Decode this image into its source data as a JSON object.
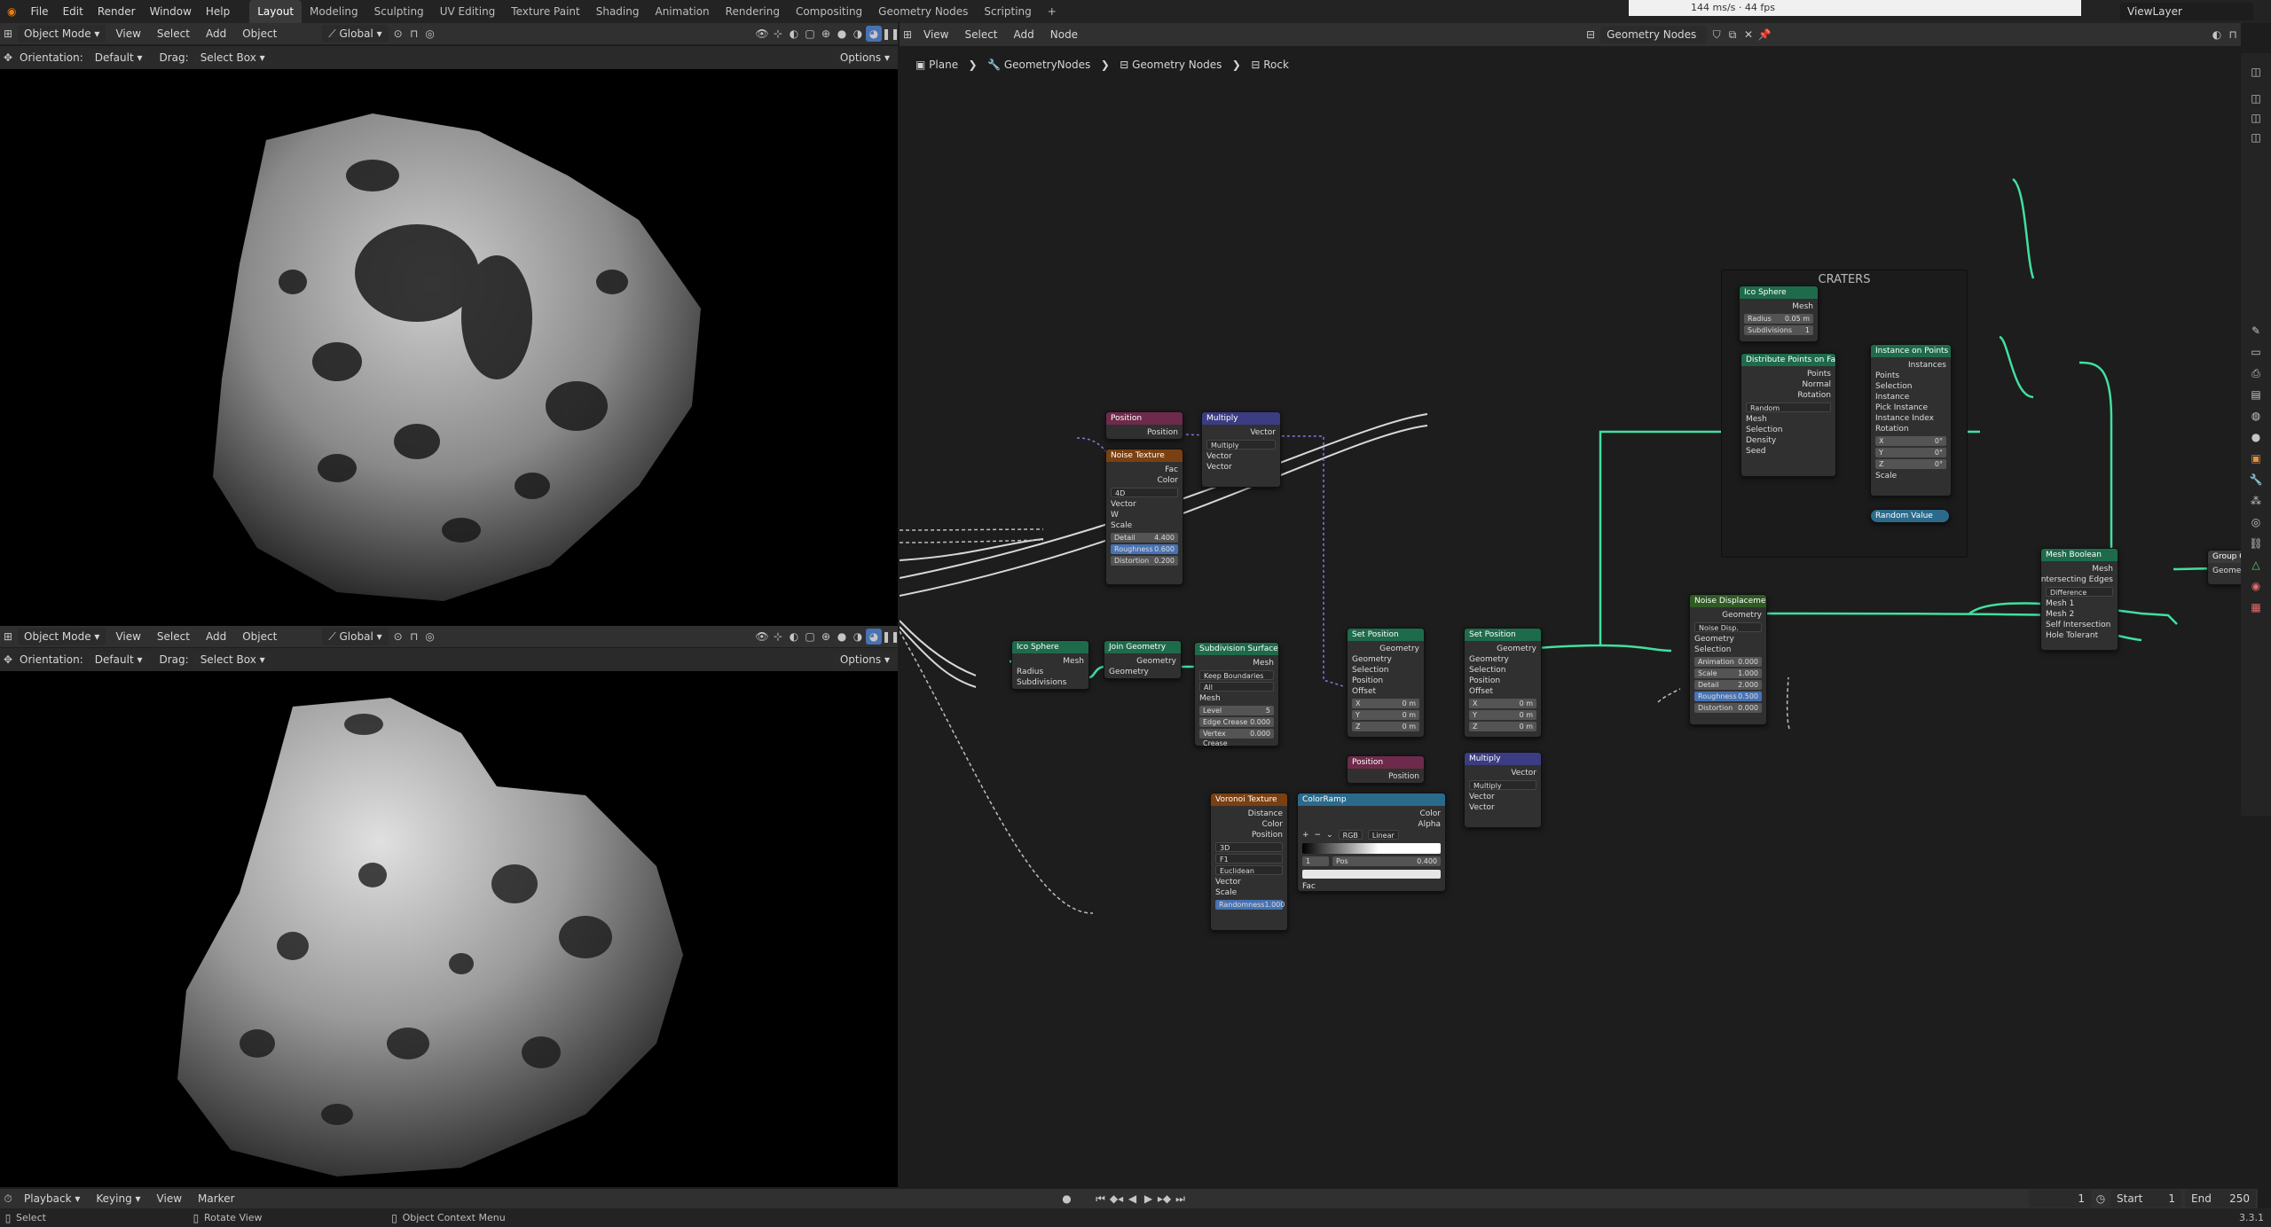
{
  "menu": {
    "items": [
      "File",
      "Edit",
      "Render",
      "Window",
      "Help"
    ],
    "workspaces": [
      "Layout",
      "Modeling",
      "Sculpting",
      "UV Editing",
      "Texture Paint",
      "Shading",
      "Animation",
      "Rendering",
      "Compositing",
      "Geometry Nodes",
      "Scripting"
    ],
    "active_workspace": "Layout",
    "add_tab": "+",
    "fps_overlay": "144 ms/s · 44 fps",
    "view_layer": "ViewLayer"
  },
  "viewport_top": {
    "mode": "Object Mode",
    "menus": [
      "View",
      "Select",
      "Add",
      "Object"
    ],
    "transform": "Global",
    "orientation_label": "Orientation:",
    "orientation_value": "Default",
    "drag_label": "Drag:",
    "drag_value": "Select Box",
    "options": "Options"
  },
  "viewport_bottom": {
    "mode": "Object Mode",
    "menus": [
      "View",
      "Select",
      "Add",
      "Object"
    ],
    "transform": "Global",
    "orientation_label": "Orientation:",
    "orientation_value": "Default",
    "drag_label": "Drag:",
    "drag_value": "Select Box",
    "options": "Options"
  },
  "node_editor": {
    "menus": [
      "View",
      "Select",
      "Add",
      "Node"
    ],
    "tree_name": "Geometry Nodes",
    "breadcrumb": [
      "Plane",
      "GeometryNodes",
      "Geometry Nodes",
      "Rock"
    ],
    "frame_label": "CRATERS",
    "nodes": {
      "ico_sphere_top": {
        "title": "Ico Sphere",
        "out": "Mesh",
        "radius_label": "Radius",
        "radius": "0.05 m",
        "subdiv_label": "Subdivisions",
        "subdiv": "1"
      },
      "distribute": {
        "title": "Distribute Points on Faces",
        "outs": [
          "Points",
          "Normal",
          "Rotation"
        ],
        "mode": "Random",
        "ins": [
          "Mesh",
          "Selection",
          "Density",
          "Seed"
        ]
      },
      "instance": {
        "title": "Instance on Points",
        "out": "Instances",
        "ins": [
          "Points",
          "Selection",
          "Instance",
          "Pick Instance",
          "Instance Index",
          "Rotation"
        ],
        "x": "0°",
        "y": "0°",
        "z": "0°",
        "scale": "Scale"
      },
      "random_value": {
        "title": "Random Value"
      },
      "position1": {
        "title": "Position",
        "out": "Position"
      },
      "multiply1": {
        "title": "Multiply",
        "out": "Vector",
        "op": "Multiply",
        "ins": [
          "Vector",
          "Vector"
        ]
      },
      "noise_tex": {
        "title": "Noise Texture",
        "outs": [
          "Fac",
          "Color"
        ],
        "dim": "4D",
        "ins": [
          "Vector",
          "W",
          "Scale"
        ],
        "detail_label": "Detail",
        "detail": "4.400",
        "rough_label": "Roughness",
        "rough": "0.600",
        "dist_label": "Distortion",
        "dist": "0.200"
      },
      "ico_sphere2": {
        "title": "Ico Sphere",
        "out": "Mesh",
        "ins": [
          "Radius",
          "Subdivisions"
        ]
      },
      "join": {
        "title": "Join Geometry",
        "out": "Geometry",
        "in": "Geometry"
      },
      "subdiv": {
        "title": "Subdivision Surface",
        "out": "Mesh",
        "mode": "Keep Boundaries",
        "uv": "All",
        "in": "Mesh",
        "level_label": "Level",
        "level": "5",
        "crease_label": "Edge Crease",
        "crease": "0.000",
        "vcrease_label": "Vertex Crease",
        "vcrease": "0.000"
      },
      "setpos1": {
        "title": "Set Position",
        "out": "Geometry",
        "ins": [
          "Geometry",
          "Selection",
          "Position",
          "Offset"
        ],
        "x": "0 m",
        "y": "0 m",
        "z": "0 m"
      },
      "setpos2": {
        "title": "Set Position",
        "out": "Geometry",
        "ins": [
          "Geometry",
          "Selection",
          "Position",
          "Offset"
        ],
        "x": "0 m",
        "y": "0 m",
        "z": "0 m"
      },
      "noise_disp": {
        "title": "Noise Displacement",
        "out": "Geometry",
        "group": "Noise Disp.",
        "ins": [
          "Geometry",
          "Selection"
        ],
        "anim_label": "Animation",
        "anim": "0.000",
        "scale_label": "Scale",
        "scale": "1.000",
        "detail_label": "Detail",
        "detail": "2.000",
        "rough_label": "Roughness",
        "rough": "0.500",
        "dist_label": "Distortion",
        "dist": "0.000"
      },
      "boolean": {
        "title": "Mesh Boolean",
        "out": "Mesh",
        "out2": "Intersecting Edges",
        "op": "Difference",
        "ins": [
          "Mesh 1",
          "Mesh 2",
          "Self Intersection",
          "Hole Tolerant"
        ]
      },
      "group_out": {
        "title": "Group Output",
        "in": "Geometry"
      },
      "position2": {
        "title": "Position",
        "out": "Position"
      },
      "multiply2": {
        "title": "Multiply",
        "out": "Vector",
        "op": "Multiply",
        "ins": [
          "Vector",
          "Vector"
        ]
      },
      "voronoi": {
        "title": "Voronoi Texture",
        "outs": [
          "Distance",
          "Color",
          "Position"
        ],
        "dim": "3D",
        "feature": "F1",
        "metric": "Euclidean",
        "ins": [
          "Vector",
          "Scale"
        ],
        "rand_label": "Randomness",
        "rand": "1.000"
      },
      "colorramp": {
        "title": "ColorRamp",
        "outs": [
          "Color",
          "Alpha"
        ],
        "mode": "RGB",
        "interp": "Linear",
        "stop": "1",
        "pos_label": "Pos",
        "pos": "0.400",
        "in": "Fac"
      }
    }
  },
  "timeline": {
    "menus": [
      "Playback",
      "Keying",
      "View",
      "Marker"
    ],
    "current": "1",
    "start_label": "Start",
    "start": "1",
    "end_label": "End",
    "end": "250"
  },
  "status": {
    "select": "Select",
    "rotate": "Rotate View",
    "context": "Object Context Menu",
    "version": "3.3.1"
  }
}
